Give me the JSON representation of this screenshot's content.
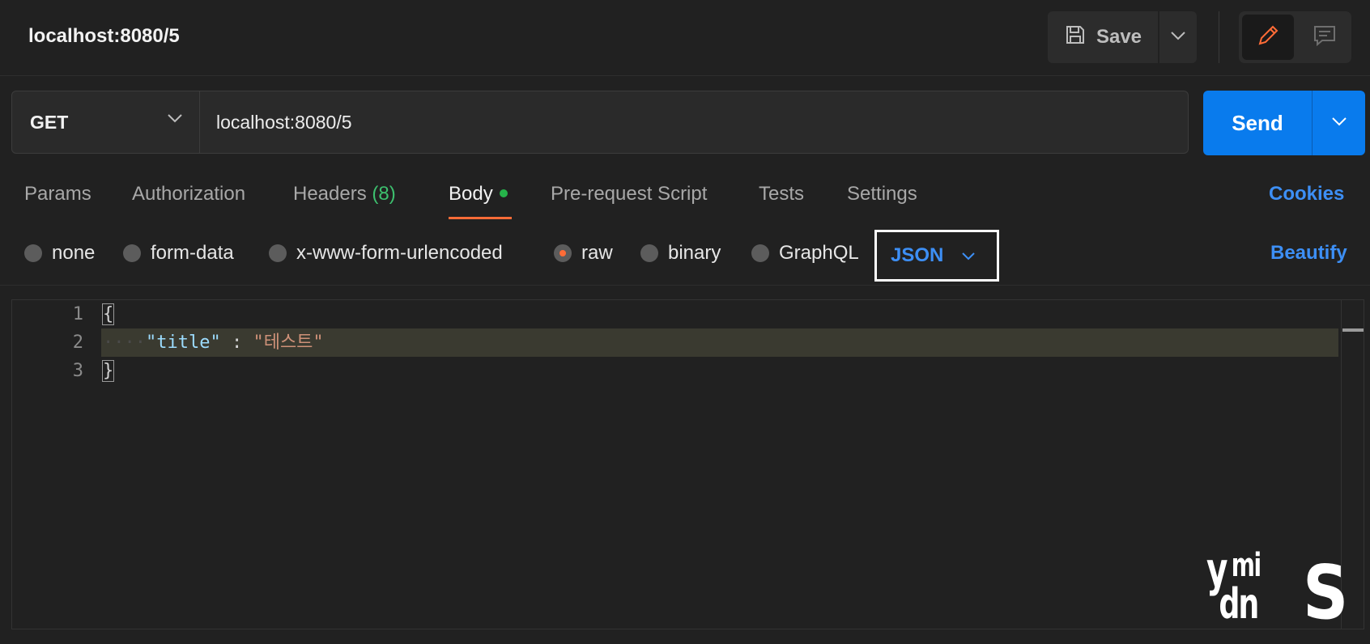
{
  "request": {
    "title": "localhost:8080/5",
    "method": "GET",
    "url": "localhost:8080/5"
  },
  "toolbar": {
    "save_label": "Save",
    "send_label": "Send"
  },
  "tabs": [
    {
      "label": "Params"
    },
    {
      "label": "Authorization"
    },
    {
      "label": "Headers",
      "count": "(8)"
    },
    {
      "label": "Body",
      "active": true
    },
    {
      "label": "Pre-request Script"
    },
    {
      "label": "Tests"
    },
    {
      "label": "Settings"
    }
  ],
  "cookies_label": "Cookies",
  "body_options": {
    "radios": [
      {
        "label": "none",
        "selected": false
      },
      {
        "label": "form-data",
        "selected": false
      },
      {
        "label": "x-www-form-urlencoded",
        "selected": false
      },
      {
        "label": "raw",
        "selected": true
      },
      {
        "label": "binary",
        "selected": false
      },
      {
        "label": "GraphQL",
        "selected": false
      }
    ],
    "format": "JSON",
    "beautify_label": "Beautify"
  },
  "editor": {
    "lines": [
      {
        "number": "1",
        "text": "{"
      },
      {
        "number": "2",
        "key": "\"title\"",
        "sep": " : ",
        "value": "\"테스트\""
      },
      {
        "number": "3",
        "text": "}"
      }
    ]
  },
  "colors": {
    "accent_blue": "#097bed",
    "active_tab_underline": "#ff6c37",
    "body_dot": "#26b34a",
    "link_blue": "#3d8ff5"
  },
  "icons": [
    "save-icon",
    "chevron-down-icon",
    "pencil-icon",
    "comment-icon"
  ],
  "watermark_text": "ydmnis"
}
